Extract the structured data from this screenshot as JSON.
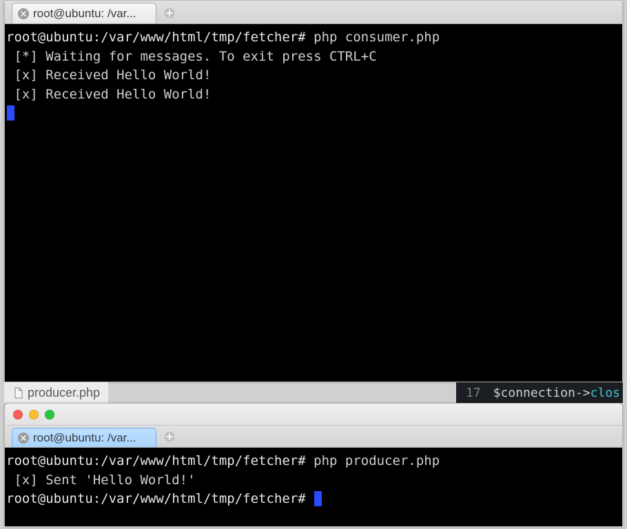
{
  "top_window": {
    "tab_title": "root@ubuntu: /var...",
    "terminal": {
      "line1_prompt": "root@ubuntu:/var/www/html/tmp/fetcher#",
      "line1_cmd": " php consumer.php",
      "line2": " [*] Waiting for messages. To exit press CTRL+C",
      "line3": " [x] Received Hello World!",
      "line4": " [x] Received Hello World!"
    }
  },
  "editor_strip": {
    "filename": "producer.php",
    "lineno": "17",
    "code_var": "$connection",
    "code_arrow": "->",
    "code_method": "clos"
  },
  "bottom_window": {
    "tab_title": "root@ubuntu: /var...",
    "terminal": {
      "line1_prompt": "root@ubuntu:/var/www/html/tmp/fetcher#",
      "line1_cmd": " php producer.php",
      "line2": " [x] Sent 'Hello World!'",
      "line3_prompt": "root@ubuntu:/var/www/html/tmp/fetcher#",
      "line3_cmd": " "
    }
  }
}
